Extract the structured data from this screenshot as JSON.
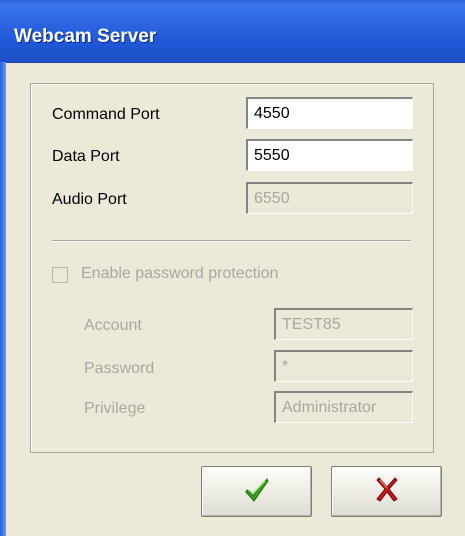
{
  "window": {
    "title": "Webcam Server"
  },
  "ports": {
    "command": {
      "label": "Command Port",
      "value": "4550"
    },
    "data": {
      "label": "Data Port",
      "value": "5550"
    },
    "audio": {
      "label": "Audio Port",
      "value": "6550"
    }
  },
  "security": {
    "enable_label": "Enable password protection",
    "enabled": false,
    "account": {
      "label": "Account",
      "value": "TEST85"
    },
    "password": {
      "label": "Password",
      "value": "*"
    },
    "privilege": {
      "label": "Privilege",
      "value": "Administrator"
    }
  },
  "buttons": {
    "ok_icon": "green-checkmark-icon",
    "cancel_icon": "red-x-icon"
  },
  "colors": {
    "titlebar": "#245edb",
    "disabled_text": "#a9a89e",
    "ok_green": "#3aa11e",
    "cancel_red": "#c81818"
  }
}
